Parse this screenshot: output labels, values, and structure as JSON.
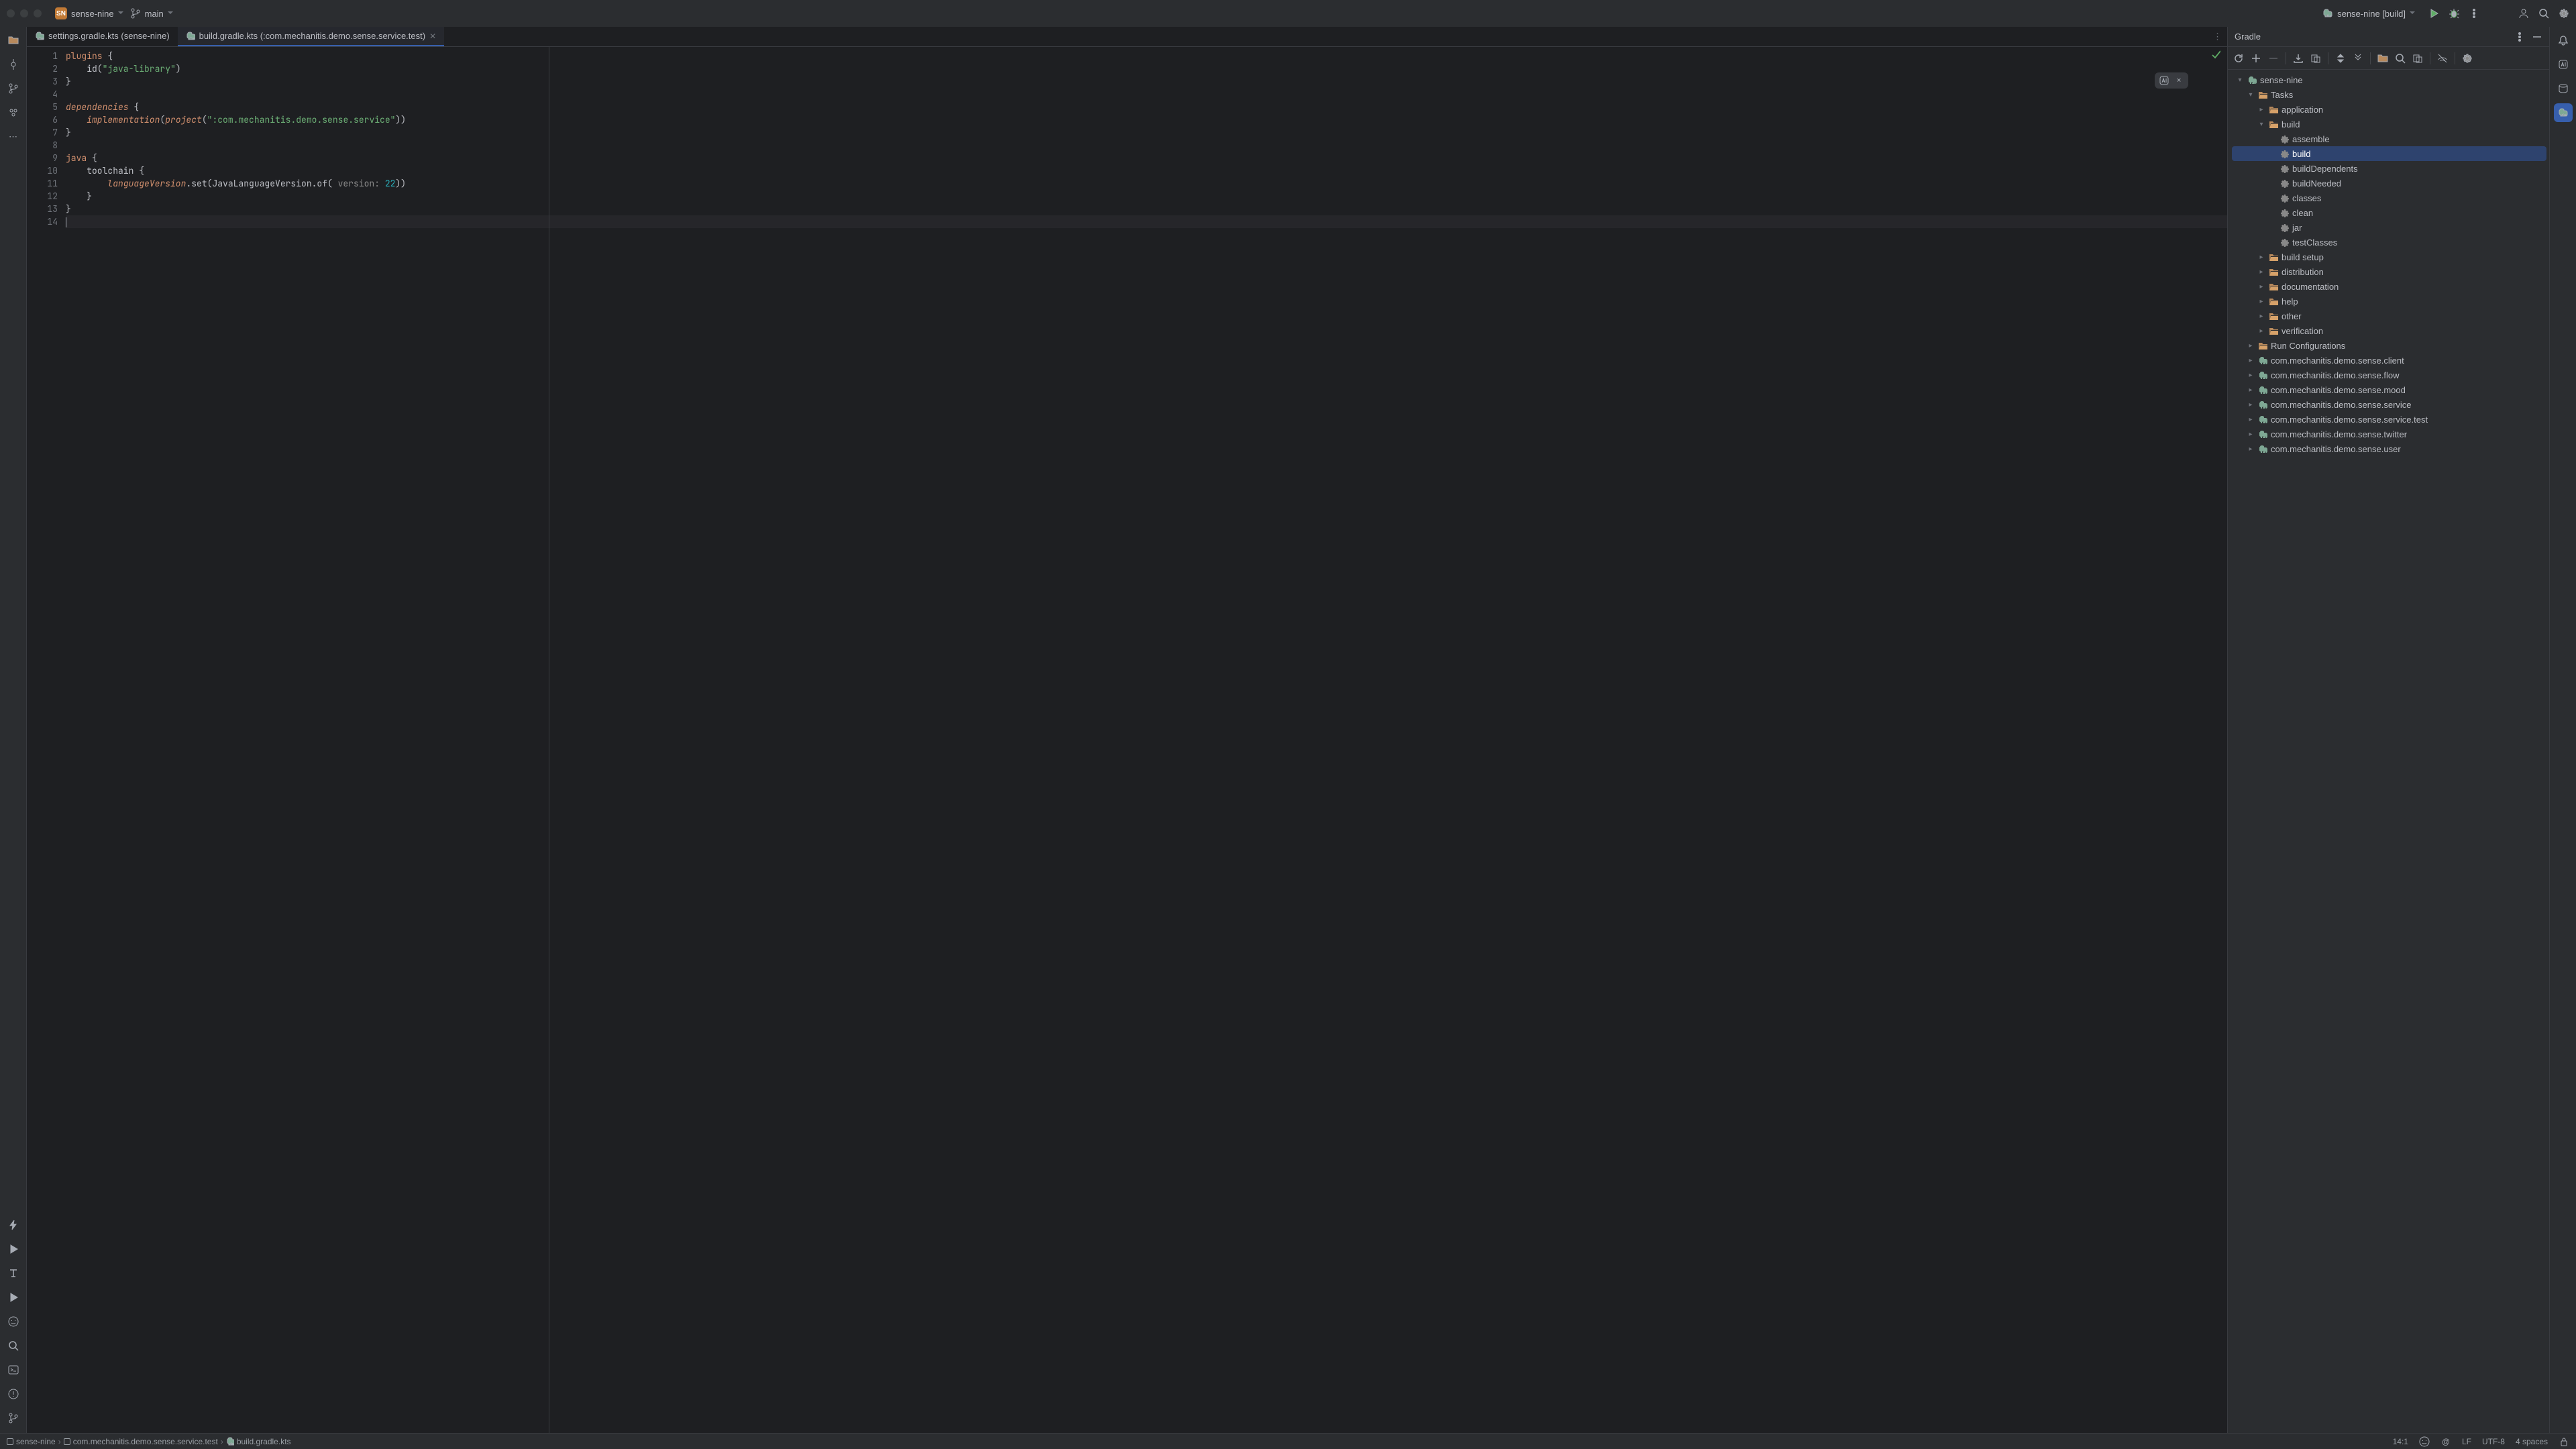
{
  "titlebar": {
    "project_badge": "SN",
    "project_name": "sense-nine",
    "branch": "main",
    "run_config": "sense-nine [build]"
  },
  "tabs": [
    {
      "label": "settings.gradle.kts (sense-nine)",
      "active": false
    },
    {
      "label": "build.gradle.kts (:com.mechanitis.demo.sense.service.test)",
      "active": true
    }
  ],
  "code": {
    "lines": [
      {
        "n": "1",
        "seg": [
          {
            "t": "plugins ",
            "c": "kw"
          },
          {
            "t": "{",
            "c": "id"
          }
        ]
      },
      {
        "n": "2",
        "seg": [
          {
            "t": "    id(",
            "c": "id"
          },
          {
            "t": "\"java-library\"",
            "c": "str"
          },
          {
            "t": ")",
            "c": "id"
          }
        ]
      },
      {
        "n": "3",
        "seg": [
          {
            "t": "}",
            "c": "id"
          }
        ]
      },
      {
        "n": "4",
        "seg": []
      },
      {
        "n": "5",
        "seg": [
          {
            "t": "dependencies ",
            "c": "fn"
          },
          {
            "t": "{",
            "c": "id"
          }
        ]
      },
      {
        "n": "6",
        "seg": [
          {
            "t": "    ",
            "c": "id"
          },
          {
            "t": "implementation",
            "c": "fn"
          },
          {
            "t": "(",
            "c": "id"
          },
          {
            "t": "project",
            "c": "fn"
          },
          {
            "t": "(",
            "c": "id"
          },
          {
            "t": "\":com.mechanitis.demo.sense.service\"",
            "c": "str"
          },
          {
            "t": "))",
            "c": "id"
          }
        ]
      },
      {
        "n": "7",
        "seg": [
          {
            "t": "}",
            "c": "id"
          }
        ]
      },
      {
        "n": "8",
        "seg": []
      },
      {
        "n": "9",
        "seg": [
          {
            "t": "java ",
            "c": "kw"
          },
          {
            "t": "{",
            "c": "id"
          }
        ]
      },
      {
        "n": "10",
        "seg": [
          {
            "t": "    toolchain ",
            "c": "id"
          },
          {
            "t": "{",
            "c": "id"
          }
        ]
      },
      {
        "n": "11",
        "seg": [
          {
            "t": "        ",
            "c": "id"
          },
          {
            "t": "languageVersion",
            "c": "fn"
          },
          {
            "t": ".set(JavaLanguageVersion.of(",
            "c": "id"
          },
          {
            "t": " version: ",
            "c": "param"
          },
          {
            "t": "22",
            "c": "num"
          },
          {
            "t": "))",
            "c": "id"
          }
        ]
      },
      {
        "n": "12",
        "seg": [
          {
            "t": "    }",
            "c": "id"
          }
        ]
      },
      {
        "n": "13",
        "seg": [
          {
            "t": "}",
            "c": "id"
          }
        ]
      },
      {
        "n": "14",
        "seg": [],
        "cursor": true
      }
    ]
  },
  "gradle": {
    "title": "Gradle",
    "tree": [
      {
        "d": 0,
        "tw": "v",
        "ic": "elephant",
        "name": "sense-nine"
      },
      {
        "d": 1,
        "tw": "v",
        "ic": "folder",
        "name": "Tasks"
      },
      {
        "d": 2,
        "tw": ">",
        "ic": "folder",
        "name": "application"
      },
      {
        "d": 2,
        "tw": "v",
        "ic": "folder",
        "name": "build"
      },
      {
        "d": 3,
        "tw": "",
        "ic": "gear",
        "name": "assemble"
      },
      {
        "d": 3,
        "tw": "",
        "ic": "gear",
        "name": "build",
        "sel": true
      },
      {
        "d": 3,
        "tw": "",
        "ic": "gear",
        "name": "buildDependents"
      },
      {
        "d": 3,
        "tw": "",
        "ic": "gear",
        "name": "buildNeeded"
      },
      {
        "d": 3,
        "tw": "",
        "ic": "gear",
        "name": "classes"
      },
      {
        "d": 3,
        "tw": "",
        "ic": "gear",
        "name": "clean"
      },
      {
        "d": 3,
        "tw": "",
        "ic": "gear",
        "name": "jar"
      },
      {
        "d": 3,
        "tw": "",
        "ic": "gear",
        "name": "testClasses"
      },
      {
        "d": 2,
        "tw": ">",
        "ic": "folder",
        "name": "build setup"
      },
      {
        "d": 2,
        "tw": ">",
        "ic": "folder",
        "name": "distribution"
      },
      {
        "d": 2,
        "tw": ">",
        "ic": "folder",
        "name": "documentation"
      },
      {
        "d": 2,
        "tw": ">",
        "ic": "folder",
        "name": "help"
      },
      {
        "d": 2,
        "tw": ">",
        "ic": "folder",
        "name": "other"
      },
      {
        "d": 2,
        "tw": ">",
        "ic": "folder",
        "name": "verification"
      },
      {
        "d": 1,
        "tw": ">",
        "ic": "folder",
        "name": "Run Configurations"
      },
      {
        "d": 1,
        "tw": ">",
        "ic": "elephant",
        "name": "com.mechanitis.demo.sense.client"
      },
      {
        "d": 1,
        "tw": ">",
        "ic": "elephant",
        "name": "com.mechanitis.demo.sense.flow"
      },
      {
        "d": 1,
        "tw": ">",
        "ic": "elephant",
        "name": "com.mechanitis.demo.sense.mood"
      },
      {
        "d": 1,
        "tw": ">",
        "ic": "elephant",
        "name": "com.mechanitis.demo.sense.service"
      },
      {
        "d": 1,
        "tw": ">",
        "ic": "elephant",
        "name": "com.mechanitis.demo.sense.service.test"
      },
      {
        "d": 1,
        "tw": ">",
        "ic": "elephant",
        "name": "com.mechanitis.demo.sense.twitter"
      },
      {
        "d": 1,
        "tw": ">",
        "ic": "elephant",
        "name": "com.mechanitis.demo.sense.user"
      }
    ]
  },
  "breadcrumbs": [
    "sense-nine",
    "com.mechanitis.demo.sense.service.test",
    "build.gradle.kts"
  ],
  "status": {
    "pos": "14:1",
    "sep": "LF",
    "enc": "UTF-8",
    "indent": "4 spaces"
  }
}
